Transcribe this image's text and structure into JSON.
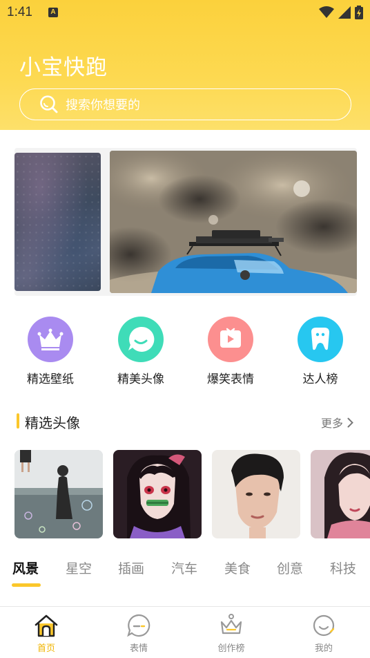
{
  "status_bar": {
    "time": "1:41",
    "notification_glyph": "A"
  },
  "header": {
    "title": "小宝快跑",
    "search_placeholder": "搜索你想要的"
  },
  "categories": [
    {
      "label": "精选壁纸",
      "icon": "crown-icon",
      "color": "#a98bf0"
    },
    {
      "label": "精美头像",
      "icon": "smile-bubble-icon",
      "color": "#3fdcb8"
    },
    {
      "label": "爆笑表情",
      "icon": "video-play-icon",
      "color": "#fc8f8f"
    },
    {
      "label": "达人榜",
      "icon": "tooth-icon",
      "color": "#27c7f0"
    }
  ],
  "featured": {
    "title": "精选头像",
    "more_label": "更多"
  },
  "tabs": [
    {
      "label": "风景",
      "active": true
    },
    {
      "label": "星空",
      "active": false
    },
    {
      "label": "插画",
      "active": false
    },
    {
      "label": "汽车",
      "active": false
    },
    {
      "label": "美食",
      "active": false
    },
    {
      "label": "创意",
      "active": false
    },
    {
      "label": "科技",
      "active": false
    }
  ],
  "bottom_nav": [
    {
      "label": "首页",
      "icon": "home-icon",
      "active": true
    },
    {
      "label": "表情",
      "icon": "emoji-bubble-icon",
      "active": false
    },
    {
      "label": "创作榜",
      "icon": "crown-icon",
      "active": false
    },
    {
      "label": "我的",
      "icon": "profile-icon",
      "active": false
    }
  ],
  "colors": {
    "accent": "#fbc72b",
    "header": "#fdd64c"
  }
}
